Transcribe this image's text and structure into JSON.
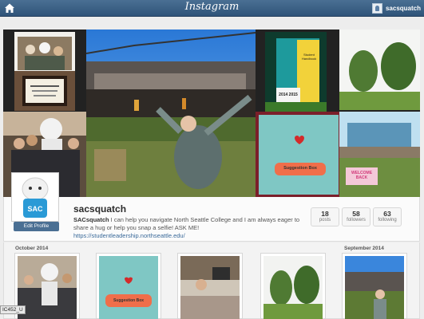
{
  "topbar": {
    "brand": "Instagram",
    "username": "sacsquatch",
    "home_icon": "home-icon"
  },
  "profile": {
    "username": "sacsquatch",
    "bio_name": "SACsquatch",
    "bio_text": " I can help you navigate North Seattle College and I am always eager to share a hug or help you snap a selfie! ASK ME! ",
    "bio_link": "https://studentleadership.northseattle.edu/",
    "edit_label": "Edit Profile",
    "avatar_text": "SAC",
    "stats": [
      {
        "num": "18",
        "label": "posts"
      },
      {
        "num": "58",
        "label": "followers"
      },
      {
        "num": "63",
        "label": "following"
      }
    ]
  },
  "mosaic": {
    "sign_text": "Suggestion Box",
    "banner_text": "WELCOME BACK",
    "book_title": "Student Handbook",
    "book_years": "2014 2015"
  },
  "feed": {
    "month_left": "October 2014",
    "month_right": "September 2014",
    "card_sign_text": "Suggestion Box"
  },
  "corner_tag": "IC452_U"
}
